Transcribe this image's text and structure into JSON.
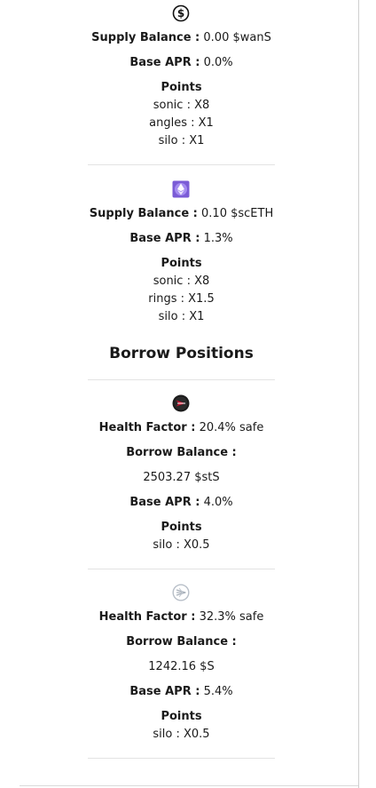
{
  "supply": [
    {
      "icon": "dollar-circle-icon",
      "supply_balance_label": "Supply Balance :",
      "supply_balance_value": "0.00 $wanS",
      "base_apr_label": "Base APR :",
      "base_apr_value": "0.0%",
      "points_label": "Points",
      "points": [
        "sonic : X8",
        "angles : X1",
        "silo : X1"
      ]
    },
    {
      "icon": "eth-token-icon",
      "supply_balance_label": "Supply Balance :",
      "supply_balance_value": "0.10 $scETH",
      "base_apr_label": "Base APR :",
      "base_apr_value": "1.3%",
      "points_label": "Points",
      "points": [
        "sonic : X8",
        "rings : X1.5",
        "silo : X1"
      ]
    }
  ],
  "borrow_heading": "Borrow Positions",
  "borrow": [
    {
      "icon": "sts-token-icon",
      "health_factor_label": "Health Factor :",
      "health_factor_value": "20.4% safe",
      "borrow_balance_label": "Borrow Balance :",
      "borrow_balance_value": "2503.27 $stS",
      "base_apr_label": "Base APR :",
      "base_apr_value": "4.0%",
      "points_label": "Points",
      "points": [
        "silo : X0.5"
      ]
    },
    {
      "icon": "sonic-token-icon",
      "health_factor_label": "Health Factor :",
      "health_factor_value": "32.3% safe",
      "borrow_balance_label": "Borrow Balance :",
      "borrow_balance_value": "1242.16 $S",
      "base_apr_label": "Base APR :",
      "base_apr_value": "5.4%",
      "points_label": "Points",
      "points": [
        "silo : X0.5"
      ]
    }
  ],
  "colors": {
    "text": "#1a1a1a",
    "separator": "#e3e3e3",
    "eth_purple": "#7b5cd6",
    "sts_red": "#c8102e"
  }
}
